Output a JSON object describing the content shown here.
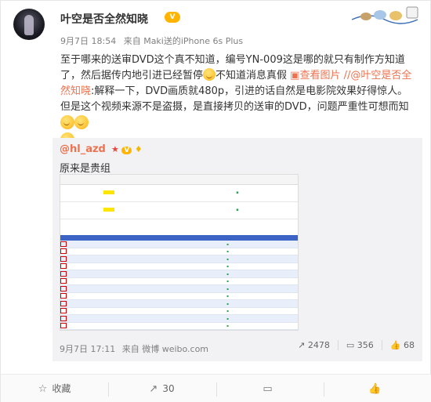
{
  "header": {
    "username": "叶空是否全然知晓",
    "vip_label": "V",
    "time": "9月7日 18:54",
    "source": "来自 Maki送的iPhone 6s Plus"
  },
  "post": {
    "seg1": "至于哪来的送审DVD这个真不知道，编号YN-009这是哪的就只有制作方知道了，然后据传内地引进已经暂停",
    "seg2": "不知道消息真假",
    "pic_link": "查看图片",
    "mention": "//@叶空是否全然知晓",
    "seg3": ":解释一下，DVD画质就480p，引进的话自然是电影院效果好得惊人。但是这个视频来源不是盗摄，是直接拷贝的送审的DVD，问题严重性可想而知"
  },
  "repost": {
    "user": "@hl_azd",
    "text": "原来是贵组",
    "time": "9月7日 17:11",
    "source": "来自 微博 weibo.com",
    "share_count": "2478",
    "comment_count": "356",
    "like_count": "68"
  },
  "footer": {
    "favorite": "收藏",
    "share": "30",
    "comment": "",
    "like": ""
  },
  "colors": {
    "link": "#eb7350",
    "vip": "#ffb400",
    "repost_bg": "#f2f2f5"
  },
  "icons": {
    "share": "share-icon",
    "comment": "comment-icon",
    "like": "like-icon",
    "favorite": "star-icon",
    "picture": "picture-icon"
  }
}
